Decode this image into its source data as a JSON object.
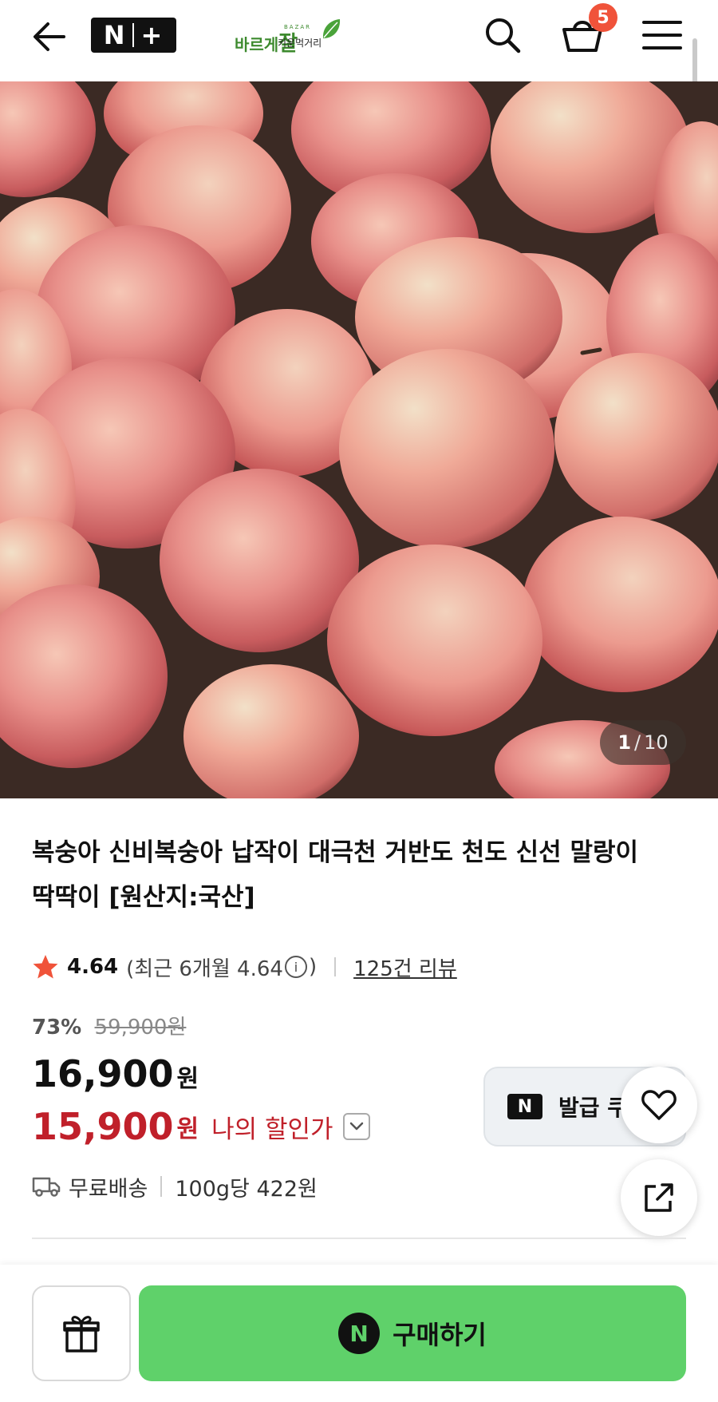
{
  "header": {
    "badge_logo": "N+",
    "brand_main_1": "바르게",
    "brand_main_2": "잘",
    "brand_eng": "BAZAR",
    "brand_sub": "키운먹거리",
    "cart_count": "5"
  },
  "gallery": {
    "current": "1",
    "separator": "/",
    "total": "10"
  },
  "product": {
    "title": "복숭아 신비복숭아 납작이 대극천 거반도 천도 신선 말랑이 딱딱이 [원산지:국산]",
    "rating": "4.64",
    "rating_recent_prefix": "(최근 6개월 4.64",
    "rating_recent_suffix": ")",
    "review_count": "125건 리뷰",
    "discount_pct": "73%",
    "original_price": "59,900원",
    "price": "16,900",
    "price_unit": "원",
    "my_price": "15,900",
    "my_price_unit": "원",
    "my_price_label": "나의 할인가",
    "coupon_label": "발급 쿠",
    "shipping": "무료배송",
    "unit_price": "100g당 422원"
  },
  "bottom_bar": {
    "buy_label": "구매하기",
    "buy_icon": "N"
  },
  "colors": {
    "buy_green": "#5fd16a",
    "discount_red": "#c0202a",
    "badge_orange": "#f0533a",
    "star_orange": "#f0533a"
  },
  "icons": [
    "back-arrow-icon",
    "search-icon",
    "cart-icon",
    "menu-icon",
    "star-icon",
    "info-icon",
    "chevron-down-icon",
    "heart-icon",
    "share-icon",
    "truck-icon",
    "gift-icon"
  ]
}
